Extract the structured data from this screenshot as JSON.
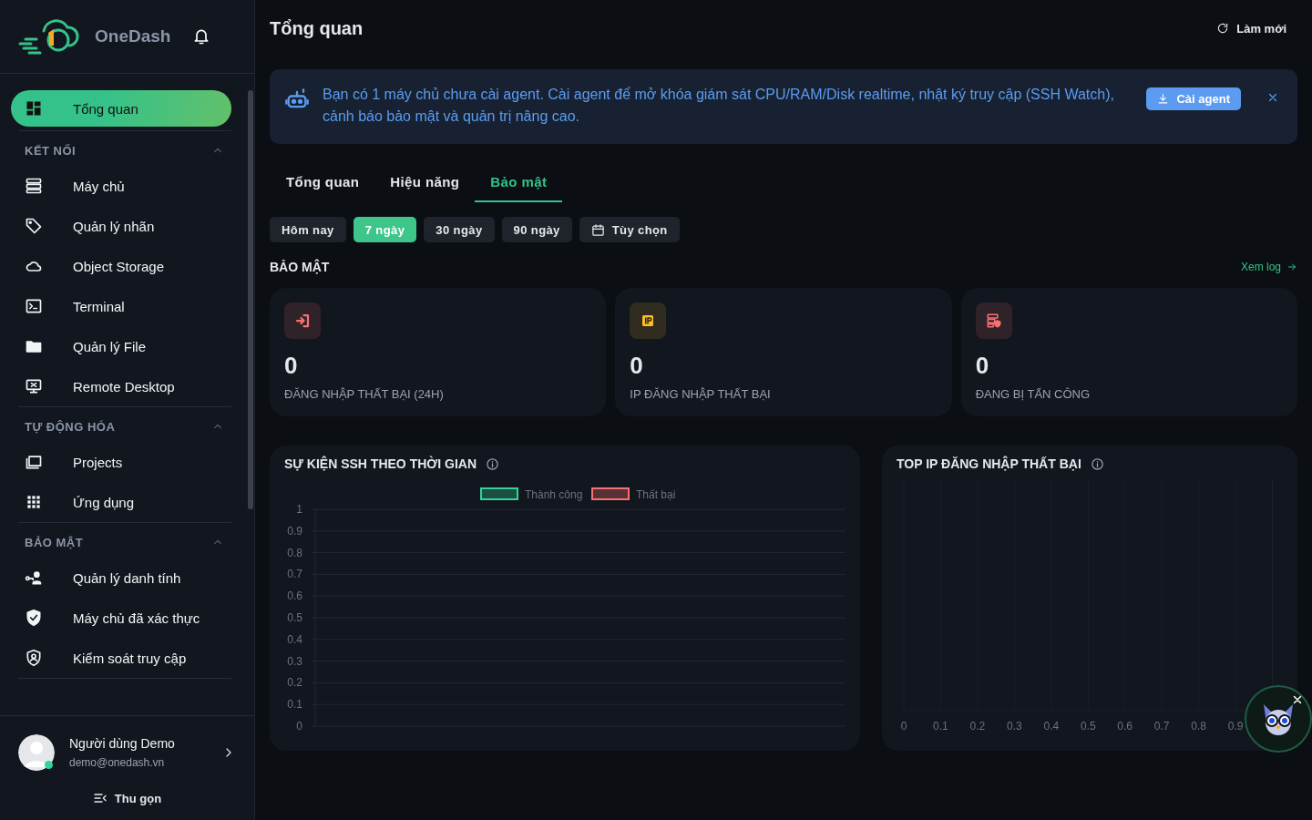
{
  "sidebar": {
    "brand": "OneDash",
    "nav": [
      {
        "kind": "item",
        "label": "Tổng quan",
        "selected": true
      },
      {
        "kind": "group",
        "title": "KẾT NỐI",
        "expanded": true,
        "items": [
          {
            "label": "Máy chủ",
            "selected": false
          },
          {
            "label": "Quản lý nhãn",
            "selected": false
          },
          {
            "label": "Object Storage",
            "selected": false
          },
          {
            "label": "Terminal",
            "selected": false
          },
          {
            "label": "Quản lý File",
            "selected": false
          },
          {
            "label": "Remote Desktop",
            "selected": false
          }
        ]
      },
      {
        "kind": "group",
        "title": "TỰ ĐỘNG HÓA",
        "expanded": true,
        "items": [
          {
            "label": "Projects",
            "selected": false
          },
          {
            "label": "Ứng dụng",
            "selected": false
          }
        ]
      },
      {
        "kind": "group",
        "title": "BẢO MẬT",
        "expanded": true,
        "items": [
          {
            "label": "Quản lý danh tính",
            "selected": false
          },
          {
            "label": "Máy chủ đã xác thực",
            "selected": false
          },
          {
            "label": "Kiểm soát truy cập",
            "selected": false
          }
        ]
      }
    ],
    "user": {
      "name": "Người dùng Demo",
      "email": "demo@onedash.vn",
      "online": true
    },
    "collapse": "Thu gọn"
  },
  "main": {
    "title": "Tổng quan",
    "refresh": "Làm mới",
    "banner": {
      "text": "Bạn có 1 máy chủ chưa cài agent. Cài agent để mở khóa giám sát CPU/RAM/Disk realtime, nhật ký truy cập (SSH Watch), cảnh báo bảo mật và quản trị nâng cao.",
      "button": "Cài agent"
    },
    "tabs": [
      {
        "label": "Tổng quan",
        "selected": false
      },
      {
        "label": "Hiệu năng",
        "selected": false
      },
      {
        "label": "Bảo mật",
        "selected": true
      }
    ],
    "ranges": [
      {
        "kind": "preset",
        "label": "Hôm nay",
        "selected": false
      },
      {
        "kind": "preset",
        "label": "7 ngày",
        "selected": true
      },
      {
        "kind": "preset",
        "label": "30 ngày",
        "selected": false
      },
      {
        "kind": "preset",
        "label": "90 ngày",
        "selected": false
      },
      {
        "kind": "custom",
        "label": "Tùy chọn",
        "selected": false
      }
    ],
    "section": {
      "title": "BẢO MẬT",
      "link": "Xem log"
    },
    "stats": [
      {
        "value": "0",
        "label": "ĐĂNG NHẬP THẤT BẠI (24H)",
        "color": "#f87171"
      },
      {
        "value": "0",
        "label": "IP ĐĂNG NHẬP THẤT BẠI",
        "color": "#fbbf24"
      },
      {
        "value": "0",
        "label": "ĐANG BỊ TẤN CÔNG",
        "color": "#f87171"
      }
    ],
    "ssh_chart": {
      "chart_data": {
        "type": "line",
        "title": "SỰ KIỆN SSH THEO THỜI GIAN",
        "series": [
          {
            "name": "Thành công",
            "color": "#34d399"
          },
          {
            "name": "Thất bại",
            "color": "#f87171"
          }
        ],
        "grid": true,
        "ylim": [
          0,
          1
        ],
        "yticks": [
          0,
          0.1,
          0.2,
          0.3,
          0.4,
          0.5,
          0.6,
          0.7,
          0.8,
          0.9,
          1
        ]
      }
    },
    "ip_chart": {
      "chart_data": {
        "type": "bar",
        "orientation": "horizontal",
        "categories": [
          null
        ],
        "values": [
          null
        ],
        "grid": true,
        "title": "TOP IP ĐĂNG NHẬP THẤT BẠI",
        "xlim": [
          0,
          1
        ],
        "xticks": [
          0,
          0.1,
          0.2,
          0.3,
          0.4,
          0.5,
          0.6,
          0.7,
          0.8,
          0.9
        ]
      }
    }
  }
}
